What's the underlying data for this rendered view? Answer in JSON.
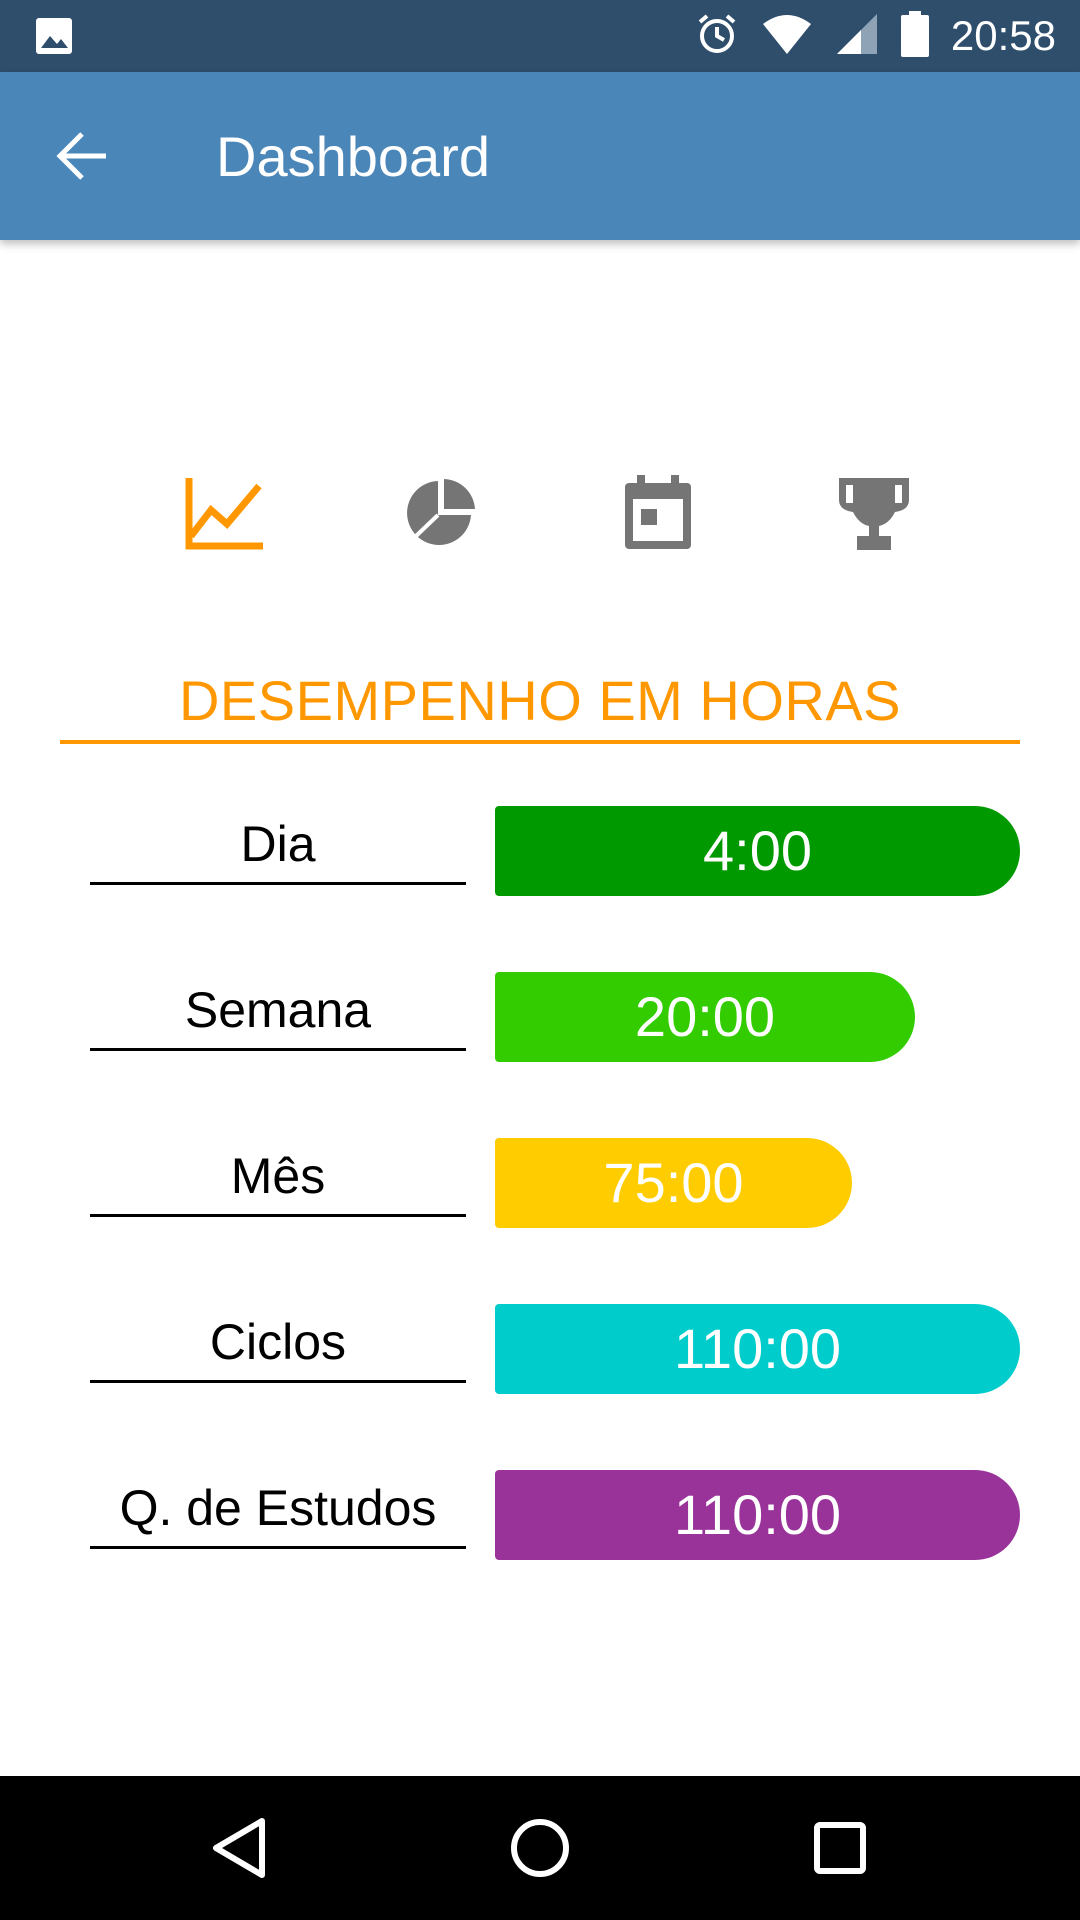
{
  "status_bar": {
    "time": "20:58",
    "icons": [
      "image-icon",
      "alarm-icon",
      "wifi-icon",
      "signal-icon",
      "battery-icon"
    ]
  },
  "app_bar": {
    "title": "Dashboard",
    "back_icon": "arrow-back-icon"
  },
  "tabs": [
    {
      "icon": "line-chart-icon",
      "active": true
    },
    {
      "icon": "pie-chart-icon",
      "active": false
    },
    {
      "icon": "calendar-icon",
      "active": false
    },
    {
      "icon": "trophy-icon",
      "active": false
    }
  ],
  "section": {
    "title": "DESEMPENHO EM HORAS"
  },
  "rows": [
    {
      "label": "Dia",
      "value": "4:00",
      "color": "#009900"
    },
    {
      "label": "Semana",
      "value": "20:00",
      "color": "#33cc00"
    },
    {
      "label": "Mês",
      "value": "75:00",
      "color": "#ffcc00"
    },
    {
      "label": "Ciclos",
      "value": "110:00",
      "color": "#00cccc"
    },
    {
      "label": "Q. de Estudos",
      "value": "110:00",
      "color": "#993399"
    }
  ],
  "colors": {
    "accent": "#ff9800",
    "status_bar": "#2e4e6c",
    "app_bar": "#4a86b7",
    "inactive_icon": "#757575"
  },
  "nav_bar": {
    "icons": [
      "back-triangle-icon",
      "home-circle-icon",
      "recents-square-icon"
    ]
  }
}
